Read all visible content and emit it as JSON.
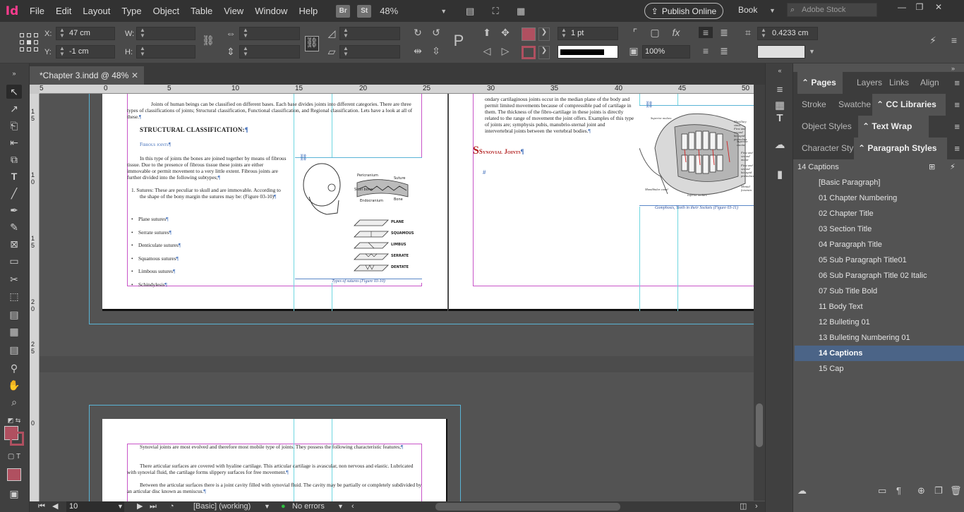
{
  "app": {
    "logo": "Id"
  },
  "menu": [
    "File",
    "Edit",
    "Layout",
    "Type",
    "Object",
    "Table",
    "View",
    "Window",
    "Help"
  ],
  "menubar": {
    "bridge": "Br",
    "stock_btn": "St",
    "zoom": "48%",
    "publish": "Publish Online",
    "workspace": "Book",
    "search_placeholder": "Adobe Stock"
  },
  "control": {
    "x_label": "X:",
    "x_value": "47 cm",
    "y_label": "Y:",
    "y_value": "-1 cm",
    "w_label": "W:",
    "h_label": "H:",
    "stroke_weight": "1 pt",
    "scale": "100%",
    "gap_value": "0.4233 cm"
  },
  "document": {
    "tab_title": "*Chapter 3.indd @ 48%"
  },
  "rulers": {
    "h_labels": [
      "5",
      "0",
      "5",
      "10",
      "15",
      "20",
      "25",
      "30",
      "35",
      "40",
      "45",
      "50"
    ],
    "v_labels": [
      "1",
      "5",
      "1",
      "0",
      "1",
      "5",
      "2",
      "0",
      "2",
      "5",
      "3",
      "0",
      "0"
    ]
  },
  "page_left": {
    "intro": "Joints of human beings can be classified on different bases. Each base divides joints into different categories. There are three types of classifications of joints; Structural classification, Functional classification, and Regional classification. Lets have a look at all of these.",
    "heading": "STRUCTURAL CLASSIFICATION:",
    "subheading": "Fibrous joints",
    "para": "In this type of joints the bones are joined together by means of fibrous tissue. Due to the presence of fibrous tissue these joints are either immovable or permit movement to a very little extent. Fibrous joints are further divided into the following subtypes;",
    "numbered": "1.  Sutures: These are peculiar to skull and are immovable. According to the shape of the bony margin the sutures may be: (Figure 03-10)",
    "bullets": [
      "Plane sutures",
      "Serrate sutures",
      "Denticulate sutures",
      "Squamous sutures",
      "Limbous sutures",
      "Schindylesis"
    ],
    "figure_labels": [
      "Pericranium",
      "Suture",
      "Skull bone",
      "Endocranium",
      "Bone",
      "PLANE",
      "SQUAMOUS",
      "LIMBUS",
      "SERRATE",
      "DENTATE"
    ],
    "caption": "Types of sutures (Figure 03-10)"
  },
  "page_right": {
    "para": "ondary cartilaginous joints occur in the median plane of the body and permit limited movements because of compressible pad of cartilage in them. The thickness of the fibro-cartilage in these joints is directly related to the range of movement the joint offers. Examples of this type of joints are; symphysis pubis, manubrio-sternal joint and intervertebral joints between the vertebral bodies.",
    "heading": "Synovial Joints",
    "figure_labels": [
      "Superior molars",
      "Maxillary sinus",
      "First and second bicuspid premolars",
      "Superior canine",
      "First and second molar",
      "First and second bicuspid premolars",
      "Mandibular canal",
      "Inferior molars",
      "Mental foramen"
    ],
    "caption": "Gomphosis, Teeth in their Sockets (Figure 03-11)"
  },
  "page_bottom": {
    "p1": "Synovial joints are most evolved and therefore most mobile type of joints. They possess the following characteristic features;",
    "p2": "There articular surfaces are covered with hyaline cartilage. This articular cartilage is avascular, non nervous and elastic. Lubricated with synovial fluid, the cartilage forms slippery surfaces for free movement.",
    "p3": "Between the articular surfaces there is a joint cavity filled with synovial fluid. The cavity may be partially or completely subdivided by an articular disc known as meniscus."
  },
  "status": {
    "page": "10",
    "style": "[Basic] (working)",
    "errors": "No errors"
  },
  "panels": {
    "row1": [
      "Pages",
      "Layers",
      "Links",
      "Align"
    ],
    "row2": [
      "Stroke",
      "Swatches",
      "CC Libraries"
    ],
    "row3": [
      "Object Styles",
      "Text Wrap"
    ],
    "row4": [
      "Character Styl",
      "Paragraph Styles"
    ],
    "current_style": "14 Captions",
    "styles": [
      "[Basic Paragraph]",
      "01 Chapter Numbering",
      "02 Chapter Title",
      "03 Section Title",
      "04 Paragraph Title",
      "05 Sub Paragraph Title01",
      "06 Sub Paragraph Title 02 Italic",
      "07 Sub Title Bold",
      "11 Body Text",
      "12 Bulleting 01",
      "13 Bulleting Numbering 01",
      "14 Captions",
      "15 Cap"
    ],
    "selected_index": 11
  },
  "colors": {
    "accent": "#4b6487",
    "app_logo": "#ff3c8e",
    "fill_swatch": "#b05060",
    "guides": "#6fd6e0",
    "margins": "#c855c8"
  }
}
